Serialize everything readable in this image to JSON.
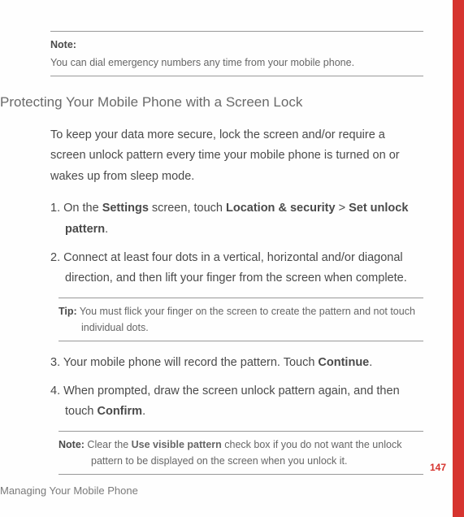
{
  "note_top": {
    "label": "Note:",
    "text": "You can dial emergency numbers any time from your mobile phone."
  },
  "section_title": "Protecting Your Mobile Phone with a Screen Lock",
  "intro": "To keep your data more secure, lock the screen and/or require a screen unlock pattern every time your mobile phone is turned on or wakes up from sleep mode.",
  "steps": {
    "s1": {
      "num": "1.",
      "pre": " On the ",
      "b1": "Settings",
      "mid1": " screen, touch ",
      "b2": "Location & security",
      "gt": " > ",
      "b3": "Set unlock pattern",
      "post": "."
    },
    "s2": {
      "num": "2.",
      "text": " Connect at least four dots in a vertical, horizontal and/or diagonal direction, and then lift your finger from the screen when complete."
    },
    "s3": {
      "num": "3.",
      "pre": " Your mobile phone will record the pattern. Touch ",
      "b1": "Continue",
      "post": "."
    },
    "s4": {
      "num": "4.",
      "pre": " When prompted, draw the screen unlock pattern again, and then touch ",
      "b1": "Confirm",
      "post": "."
    }
  },
  "tip": {
    "label": "Tip:",
    "line1": "  You must flick your finger on the screen to create the pattern and not touch",
    "line2": "individual dots."
  },
  "note_bottom": {
    "label": "Note:",
    "pre": "  Clear the ",
    "b1": "Use visible pattern",
    "mid": " check box if you do not want the unlock",
    "line2": "pattern to be displayed on the screen when you unlock it."
  },
  "page_number": "147",
  "footer": "Managing Your Mobile Phone"
}
